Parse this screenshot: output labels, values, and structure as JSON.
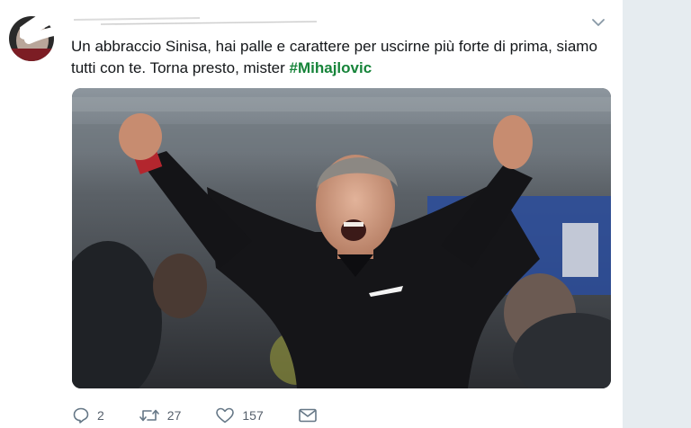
{
  "tweet": {
    "text_before": "Un abbraccio Sinisa, hai palle e carattere per uscirne più forte di prima, siamo tutti con te. Torna presto, mister ",
    "hashtag": "#Mihajlovic"
  },
  "actions": {
    "replies": "2",
    "retweets": "27",
    "likes": "157"
  },
  "icons": {
    "reply": "reply-icon",
    "retweet": "retweet-icon",
    "like": "heart-icon",
    "dm": "envelope-icon",
    "menu": "chevron-down-icon"
  },
  "colors": {
    "hashtag": "#17843a",
    "icon": "#657786",
    "background": "#e6ecf0"
  }
}
